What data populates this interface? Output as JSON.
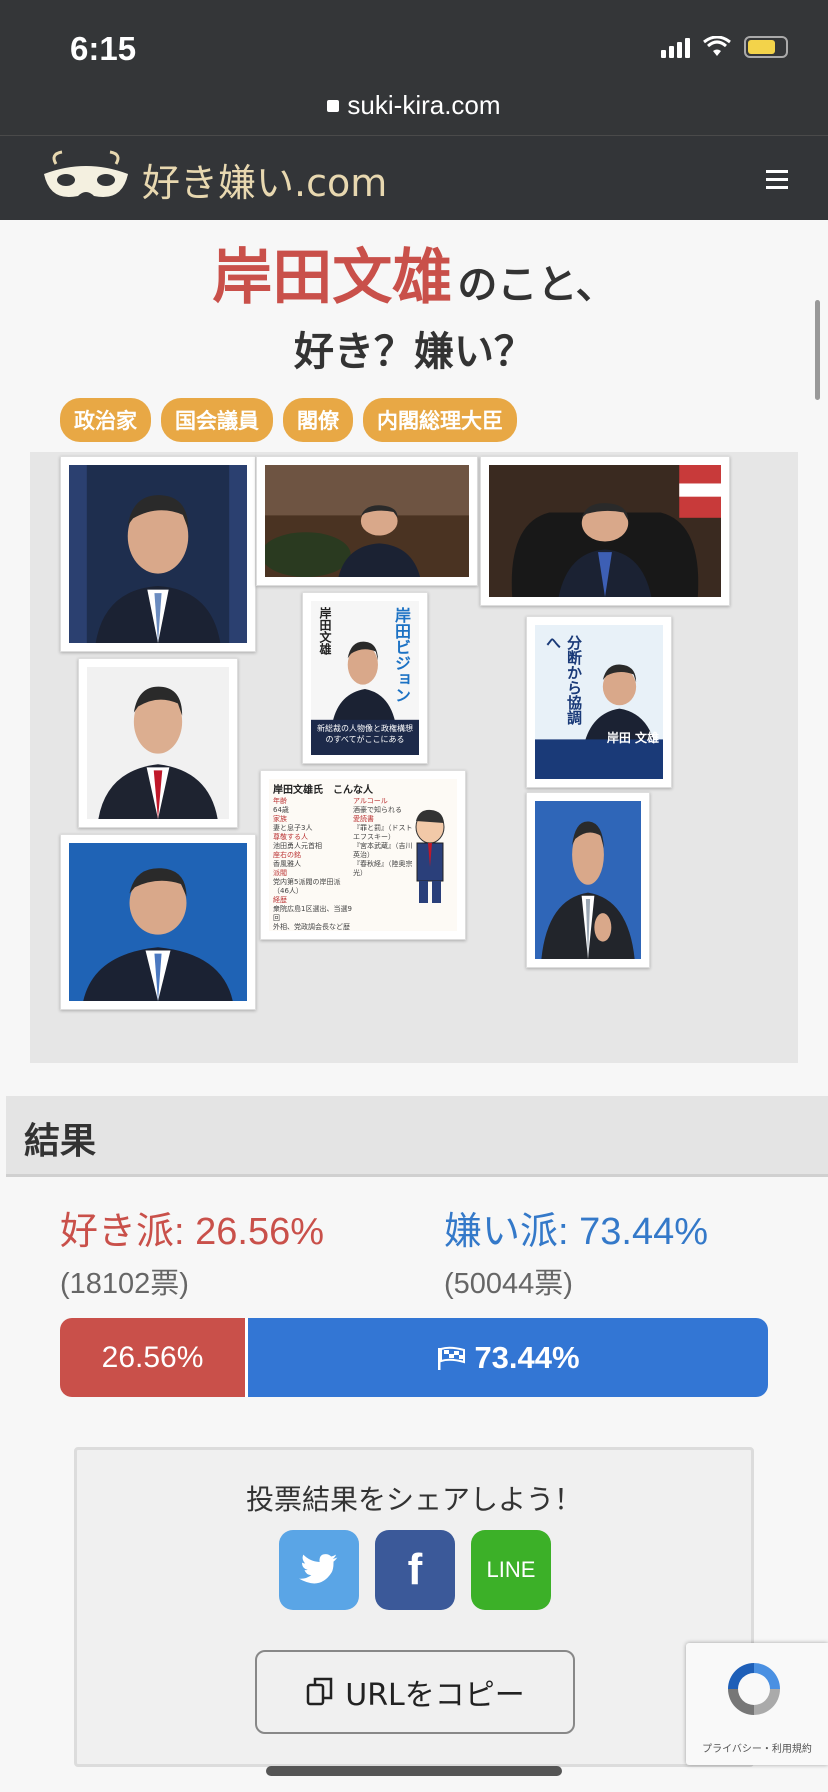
{
  "status": {
    "time": "6:15"
  },
  "browser": {
    "url": "suki-kira.com"
  },
  "site": {
    "logo_text": "好き嫌い.com"
  },
  "hero": {
    "name": "岸田文雄",
    "suffix": "のこと、",
    "question": "好き？嫌い？"
  },
  "tags": [
    "政治家",
    "国会議員",
    "閣僚",
    "内閣総理大臣"
  ],
  "gallery": {
    "book1": {
      "vertical_name": "岸田文雄",
      "title": "岸田ビジョン",
      "sub": "新総裁の人物像と政権構想のすべてがここにある"
    },
    "book2": {
      "title": "分断から協調へ",
      "author": "岸田 文雄"
    },
    "profile": {
      "title": "岸田文雄氏　こんな人",
      "items": [
        "年齢",
        "64歳",
        "家族",
        "妻と息子3人",
        "尊敬する人",
        "池田勇人元首相",
        "座右の銘",
        "香風雅人",
        "派閥",
        "党内第5派閥の岸田派（46人）",
        "経歴",
        "衆院広島1区選出、当選9回",
        "外相、党政調会長など歴任",
        "アルコール",
        "酒豪で知られる",
        "愛読書",
        "『罪と罰』（ドストエフスキー）",
        "『宮本武蔵』（吉川英治）",
        "『春秋経』（陸奥宗光）"
      ]
    }
  },
  "results": {
    "heading": "結果",
    "like_label": "好き派: 26.56%",
    "dislike_label": "嫌い派: 73.44%",
    "like_votes": "(18102票)",
    "dislike_votes": "(50044票)",
    "like_percent": 26.56,
    "dislike_percent": 73.44,
    "like_bar_text": "26.56%",
    "dislike_bar_text": "73.44%",
    "like_color": "#c9504a",
    "dislike_color": "#3376d4"
  },
  "share": {
    "title": "投票結果をシェアしよう！",
    "twitter_icon": "twitter-icon",
    "facebook_label": "f",
    "line_label": "LINE",
    "copy_label": "URLをコピー"
  },
  "recaptcha": {
    "text": "プライバシー・利用規約"
  }
}
